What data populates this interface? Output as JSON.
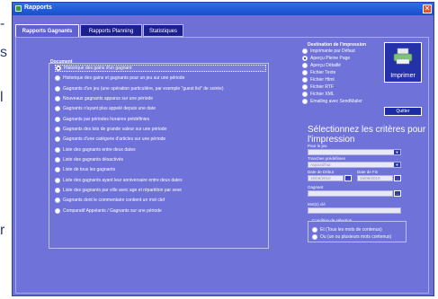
{
  "background": {
    "chars": [
      "-",
      "s",
      "l",
      "r"
    ]
  },
  "window": {
    "title": "Rapports",
    "close_glyph": "✕"
  },
  "tabs": [
    {
      "label": "Rapports Gagnants"
    },
    {
      "label": "Rapports Planning"
    },
    {
      "label": "Statistiques"
    }
  ],
  "documents": {
    "heading": "Document",
    "items": [
      {
        "label": "Historique des gains d'un gagnant",
        "checked": true
      },
      {
        "label": "Historique des gains et gagnants pour un jeu sur une période"
      },
      {
        "label": "Gagnants d'un jeu (une opération particulière, par exemple \"guest list\" de soirée)"
      },
      {
        "label": "Nouveaux gagnants apparus sur une période"
      },
      {
        "label": "Gagnants n'ayant plus appelé depuis une date"
      },
      {
        "label": "Gagnants par périodes horaires prédéfinies"
      },
      {
        "label": "Gagnants des lots de grande valeur sur une période"
      },
      {
        "label": "Gagnants d'une catégorie d'articles sur une période"
      },
      {
        "label": "Liste des gagnants entre deux dates"
      },
      {
        "label": "Liste des gagnants désactivés"
      },
      {
        "label": "Liste de tous les gagnants"
      },
      {
        "label": "Liste des gagnants ayant leur anniversaire entre deux dates"
      },
      {
        "label": "Liste des gagnants par ville avec age et répartition par sexe"
      },
      {
        "label": "Gagnants dont le commentaire contient un mot clef"
      },
      {
        "label": "Comparatif Appelants / Gagnants sur une période"
      }
    ]
  },
  "destination": {
    "heading": "Destination de l'impression",
    "items": [
      {
        "label": "Imprimante par Défaut"
      },
      {
        "label": "Aperçu Pleine Page",
        "checked": true
      },
      {
        "label": "Aperçu Détaillé"
      },
      {
        "label": "Fichier Texte"
      },
      {
        "label": "Fichier Html"
      },
      {
        "label": "Fichier RTF"
      },
      {
        "label": "Fichier XML"
      },
      {
        "label": "Emailing avec SendMailer"
      }
    ]
  },
  "buttons": {
    "print": "Imprimer",
    "quit": "Quitter"
  },
  "criteria": {
    "title": "Sélectionnez les critères pour l'impression",
    "jeu_label": "Pour le jeu",
    "jeu_arrow": "▼",
    "tranches_label": "Tranches prédéfinies",
    "tranches_value": "Aujourd'hui",
    "tranches_arrow": "▼",
    "date_debut_label": "Date de Début",
    "date_debut_value": "15/06/2010",
    "date_fin_label": "Date de Fin",
    "date_fin_value": "15/06/2010",
    "cal_glyph": "...",
    "gagnant_label": "Gagnant",
    "gagnant_btn": "...",
    "mots_label": "Mot(s) clé",
    "condition_heading": "Condition de sélection",
    "cond_items": [
      {
        "label": "Et (Tous les mots de contenus)"
      },
      {
        "label": "Ou (un ou plusieurs mots contenus)"
      }
    ]
  }
}
